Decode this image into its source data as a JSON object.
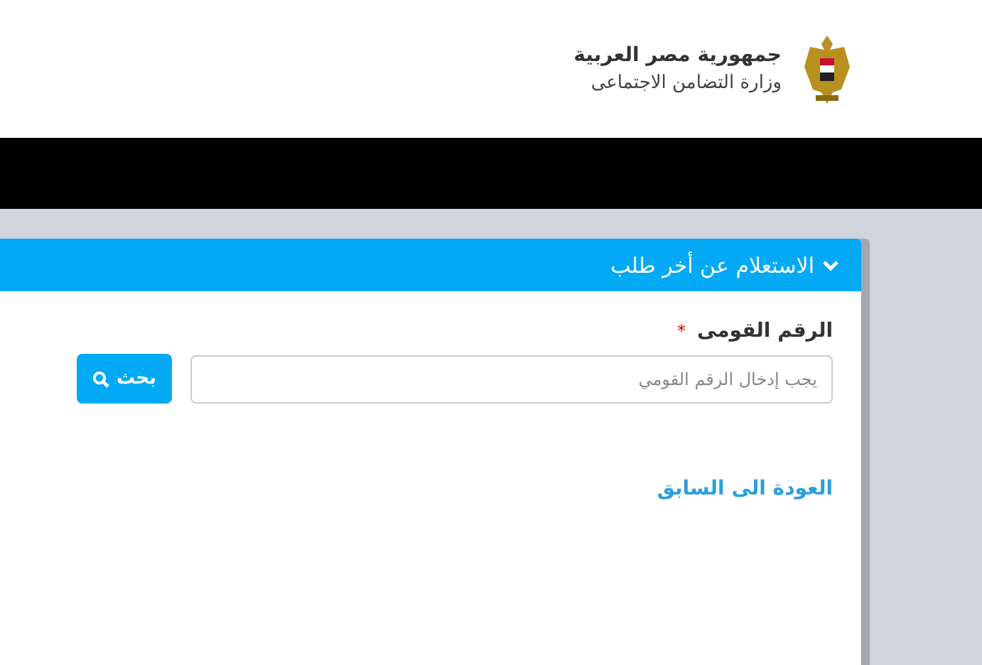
{
  "header": {
    "title": "جمهورية مصر العربية",
    "subtitle": "وزارة التضامن الاجتماعى"
  },
  "panel": {
    "title": "الاستعلام عن أخر طلب",
    "expanded": true
  },
  "form": {
    "label": "الرقم القومى",
    "required_mark": "*",
    "placeholder": "يجب إدخال الرقم القومي",
    "button": "بحث"
  },
  "back_link": "العودة الى السابق"
}
